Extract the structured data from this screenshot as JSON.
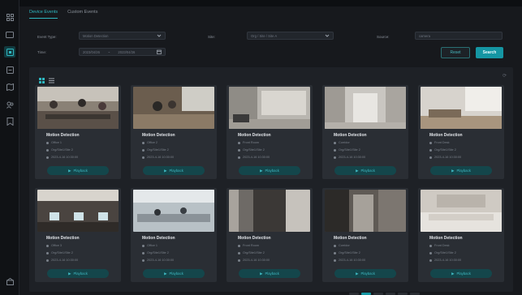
{
  "tabs": [
    {
      "label": "Device Events",
      "active": true
    },
    {
      "label": "Custom Events",
      "active": false
    }
  ],
  "filters": {
    "event_type_label": "Event Type:",
    "event_type_value": "Motion Detection",
    "site_label": "Site:",
    "site_value": "Org / Site / Site A",
    "source_label": "Source:",
    "source_value": "camera",
    "time_label": "Time:",
    "time_start": "2023/04/26",
    "time_end": "2023/04/26",
    "time_sep": "~"
  },
  "buttons": {
    "reset": "Reset",
    "search": "Search"
  },
  "cards": [
    {
      "title": "Motion Detection",
      "line1": "Office 1",
      "line2": "Org/Site1/Site 2",
      "line3": "2023-4-16 10:30:00",
      "action": "Playback"
    },
    {
      "title": "Motion Detection",
      "line1": "Office 2",
      "line2": "Org/Site1/Site 2",
      "line3": "2023-4-16 10:30:00",
      "action": "Playback"
    },
    {
      "title": "Motion Detection",
      "line1": "Front Room",
      "line2": "Org/Site1/Site 2",
      "line3": "2023-4-16 10:30:00",
      "action": "Playback"
    },
    {
      "title": "Motion Detection",
      "line1": "Corridor",
      "line2": "Org/Site1/Site 2",
      "line3": "2023-4-16 10:30:00",
      "action": "Playback"
    },
    {
      "title": "Motion Detection",
      "line1": "Front Desk",
      "line2": "Org/Site1/Site 2",
      "line3": "2023-4-16 10:30:00",
      "action": "Playback"
    },
    {
      "title": "Motion Detection",
      "line1": "Office 3",
      "line2": "Org/Site1/Site 2",
      "line3": "2023-4-16 10:30:00",
      "action": "Playback"
    },
    {
      "title": "Motion Detection",
      "line1": "Office 1",
      "line2": "Org/Site1/Site 2",
      "line3": "2023-4-16 10:30:00",
      "action": "Playback"
    },
    {
      "title": "Motion Detection",
      "line1": "Front Room",
      "line2": "Org/Site1/Site 2",
      "line3": "2023-4-16 10:30:00",
      "action": "Playback"
    },
    {
      "title": "Motion Detection",
      "line1": "Corridor",
      "line2": "Org/Site1/Site 2",
      "line3": "2023-4-16 10:30:00",
      "action": "Playback"
    },
    {
      "title": "Motion Detection",
      "line1": "Front Desk",
      "line2": "Org/Site1/Site 2",
      "line3": "2023-4-16 10:30:00",
      "action": "Playback"
    }
  ],
  "rail_icons": [
    "apps-icon",
    "camera-icon",
    "events-icon",
    "alarm-icon",
    "map-icon",
    "people-icon",
    "report-icon",
    "settings-icon"
  ],
  "accent": "#1596a3"
}
